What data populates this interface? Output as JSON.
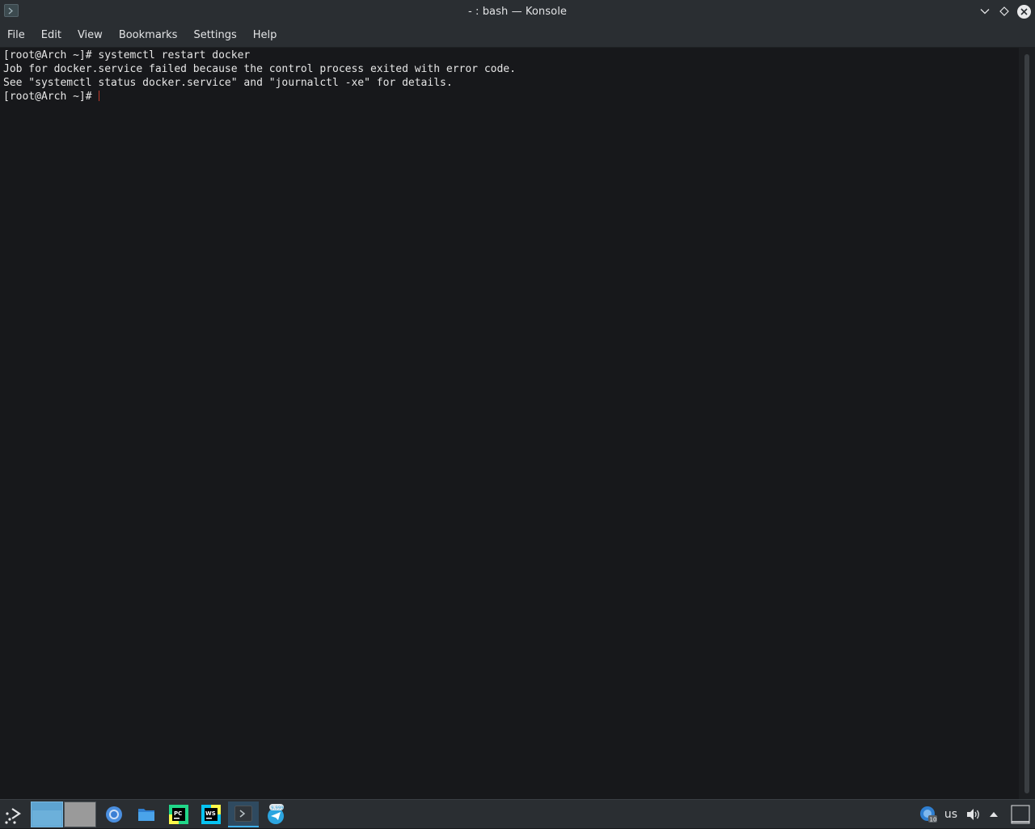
{
  "window": {
    "title": "- : bash — Konsole"
  },
  "menubar": {
    "items": [
      "File",
      "Edit",
      "View",
      "Bookmarks",
      "Settings",
      "Help"
    ]
  },
  "terminal": {
    "lines": [
      "[root@Arch ~]# systemctl restart docker",
      "Job for docker.service failed because the control process exited with error code.",
      "See \"systemctl status docker.service\" and \"journalctl -xe\" for details.",
      "[root@Arch ~]#"
    ],
    "cursor_color": "#c0392b"
  },
  "taskbar": {
    "tasks": [
      {
        "name": "chrome",
        "icon": "chrome-icon"
      },
      {
        "name": "files",
        "icon": "folder-icon"
      },
      {
        "name": "pycharm",
        "icon": "pycharm-icon",
        "label": "PC"
      },
      {
        "name": "webstorm",
        "icon": "webstorm-icon",
        "label": "WS"
      },
      {
        "name": "konsole",
        "icon": "terminal-icon",
        "active": true
      },
      {
        "name": "telegram",
        "icon": "telegram-icon",
        "badge": "9,999"
      }
    ],
    "tray": {
      "updates_count": "10",
      "keyboard_layout": "us"
    }
  },
  "colors": {
    "accent": "#3daee9",
    "background": "#17181b",
    "chrome": "#2a2e32"
  }
}
